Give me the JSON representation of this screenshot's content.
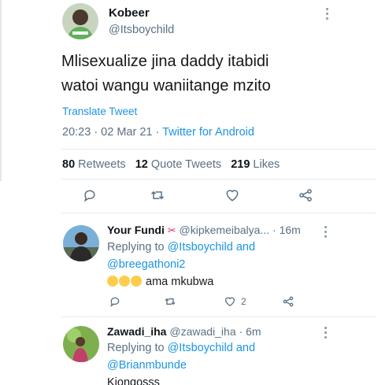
{
  "main_tweet": {
    "author_name": "Kobeer",
    "author_handle": "@Itsboychild",
    "text_line1": "Mlisexualize jina daddy itabidi",
    "text_line2": "watoi wangu waniitange mzito",
    "translate_label": "Translate Tweet",
    "timestamp": "20:23 · 02 Mar 21 · ",
    "source": "Twitter for Android",
    "retweets_count": "80",
    "retweets_label": "Retweets",
    "quote_count": "12",
    "quote_label": "Quote Tweets",
    "likes_count": "219",
    "likes_label": "Likes"
  },
  "replies": [
    {
      "author_name": "Your Fundi",
      "author_emoji": "✂",
      "author_handle": "@kipkemeibalya...",
      "time": " · 16m",
      "replying_prefix": "Replying to ",
      "replying_user1": "@Itsboychild",
      "replying_and": " and",
      "replying_user2": "@breegathoni2",
      "text": "ama mkubwa",
      "like_count": "2"
    },
    {
      "author_name": "Zawadi_iha",
      "author_handle": "@zawadi_iha",
      "time": " · 6m",
      "replying_prefix": "Replying to ",
      "replying_user1": "@Itsboychild",
      "replying_and": " and",
      "replying_user2": "@Brianmbunde",
      "text": "Kiongosss"
    }
  ],
  "icons": [
    "reply-icon",
    "retweet-icon",
    "like-icon",
    "share-icon",
    "more-icon"
  ],
  "colors": {
    "accent": "#1b95e0",
    "secondary_text": "#5b7083",
    "divider": "#e6ecf0"
  }
}
